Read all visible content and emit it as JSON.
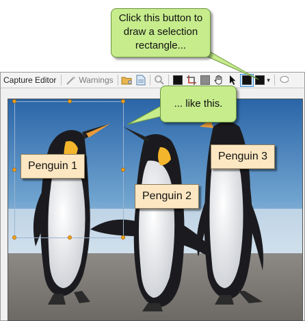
{
  "toolbar": {
    "title": "Capture Editor",
    "warnings_label": "Warnings"
  },
  "callouts": {
    "top": [
      "Click this button to",
      "draw a selection",
      "rectangle..."
    ],
    "bottom": "... like this."
  },
  "labels": {
    "penguin1": "Penguin 1",
    "penguin2": "Penguin 2",
    "penguin3": "Penguin 3"
  },
  "colors": {
    "callout_fill": "#c6ec8c",
    "label_fill": "#fde7c2",
    "handle": "#f5a623",
    "active_tool": "#3d8fd9"
  }
}
